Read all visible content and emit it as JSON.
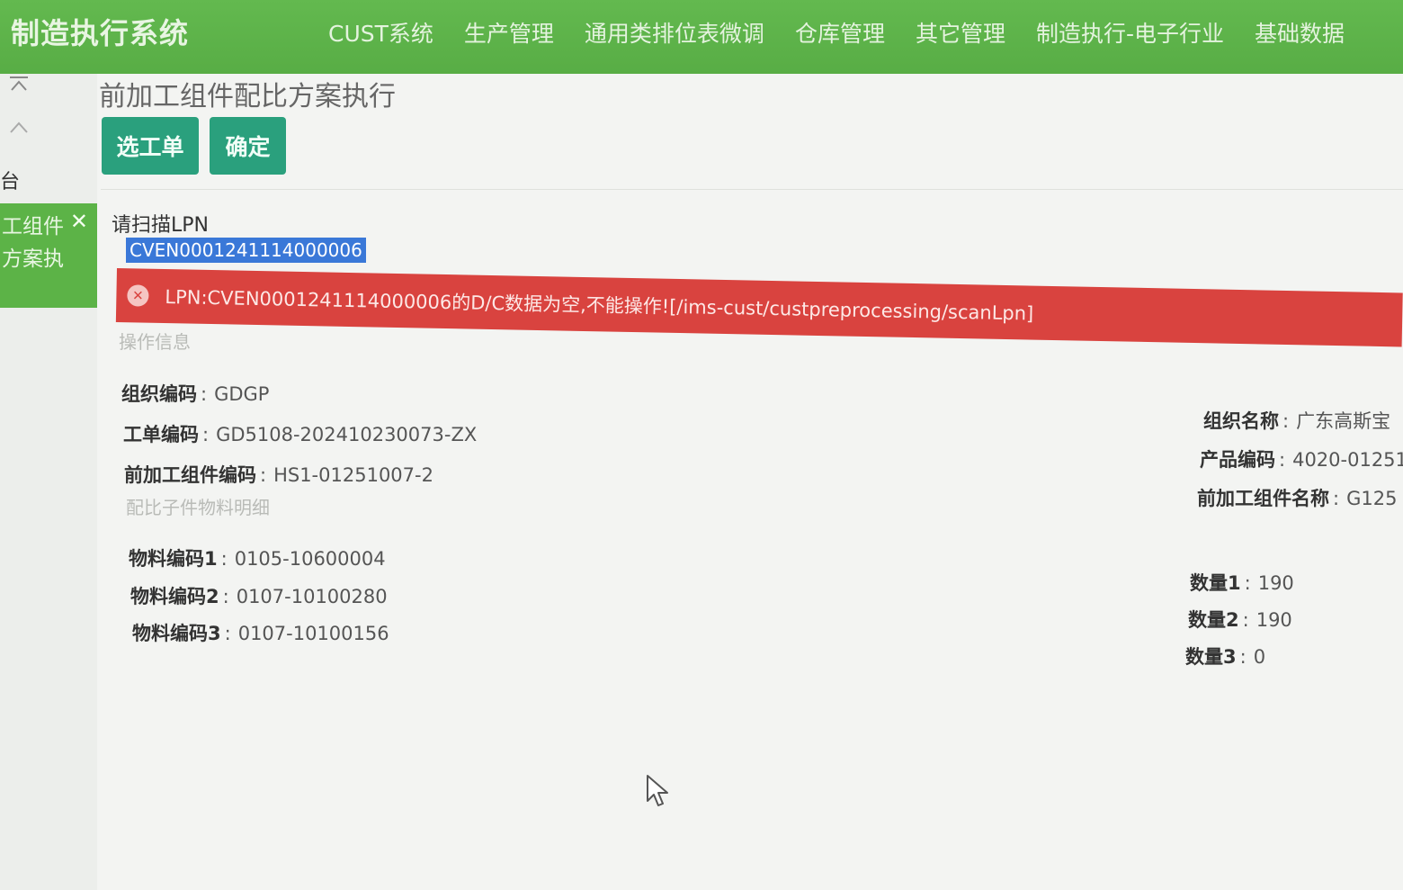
{
  "app_title": "制造执行系统",
  "nav": [
    "CUST系统",
    "生产管理",
    "通用类排位表微调",
    "仓库管理",
    "其它管理",
    "制造执行-电子行业",
    "基础数据"
  ],
  "sidebar": {
    "collapse_icon": "collapse-top-icon",
    "up_icon": "chevron-up-icon",
    "text": "台",
    "active_tab_line1": "工组件",
    "active_tab_line2": "方案执",
    "close_glyph": "✕"
  },
  "page_title": "前加工组件配比方案执行",
  "buttons": {
    "select_order": "选工单",
    "confirm": "确定"
  },
  "scan": {
    "label": "请扫描LPN",
    "value": "CVEN0001241114000006"
  },
  "error": {
    "message": "LPN:CVEN0001241114000006的D/C数据为空,不能操作![/ims-cust/custpreprocessing/scanLpn]"
  },
  "operation_info": {
    "section_title": "操作信息",
    "org_code_label": "组织编码",
    "org_code": "GDGP",
    "work_order_label": "工单编码",
    "work_order": "GD5108-202410230073-ZX",
    "component_code_label": "前加工组件编码",
    "component_code": "HS1-01251007-2",
    "org_name_label": "组织名称",
    "org_name": "广东高斯宝",
    "product_code_label": "产品编码",
    "product_code": "4020-01251",
    "component_name_label": "前加工组件名称",
    "component_name": "G125"
  },
  "materials": {
    "section_title": "配比子件物料明细",
    "rows": [
      {
        "code_label": "物料编码1",
        "code": "0105-10600004",
        "qty_label": "数量1",
        "qty": "190"
      },
      {
        "code_label": "物料编码2",
        "code": "0107-10100280",
        "qty_label": "数量2",
        "qty": "190"
      },
      {
        "code_label": "物料编码3",
        "code": "0107-10100156",
        "qty_label": "数量3",
        "qty": "0"
      }
    ]
  },
  "colors": {
    "header_green": "#5cb347",
    "button_teal": "#2aa07d",
    "error_red": "#d9433f",
    "selection_blue": "#3a78d8"
  }
}
